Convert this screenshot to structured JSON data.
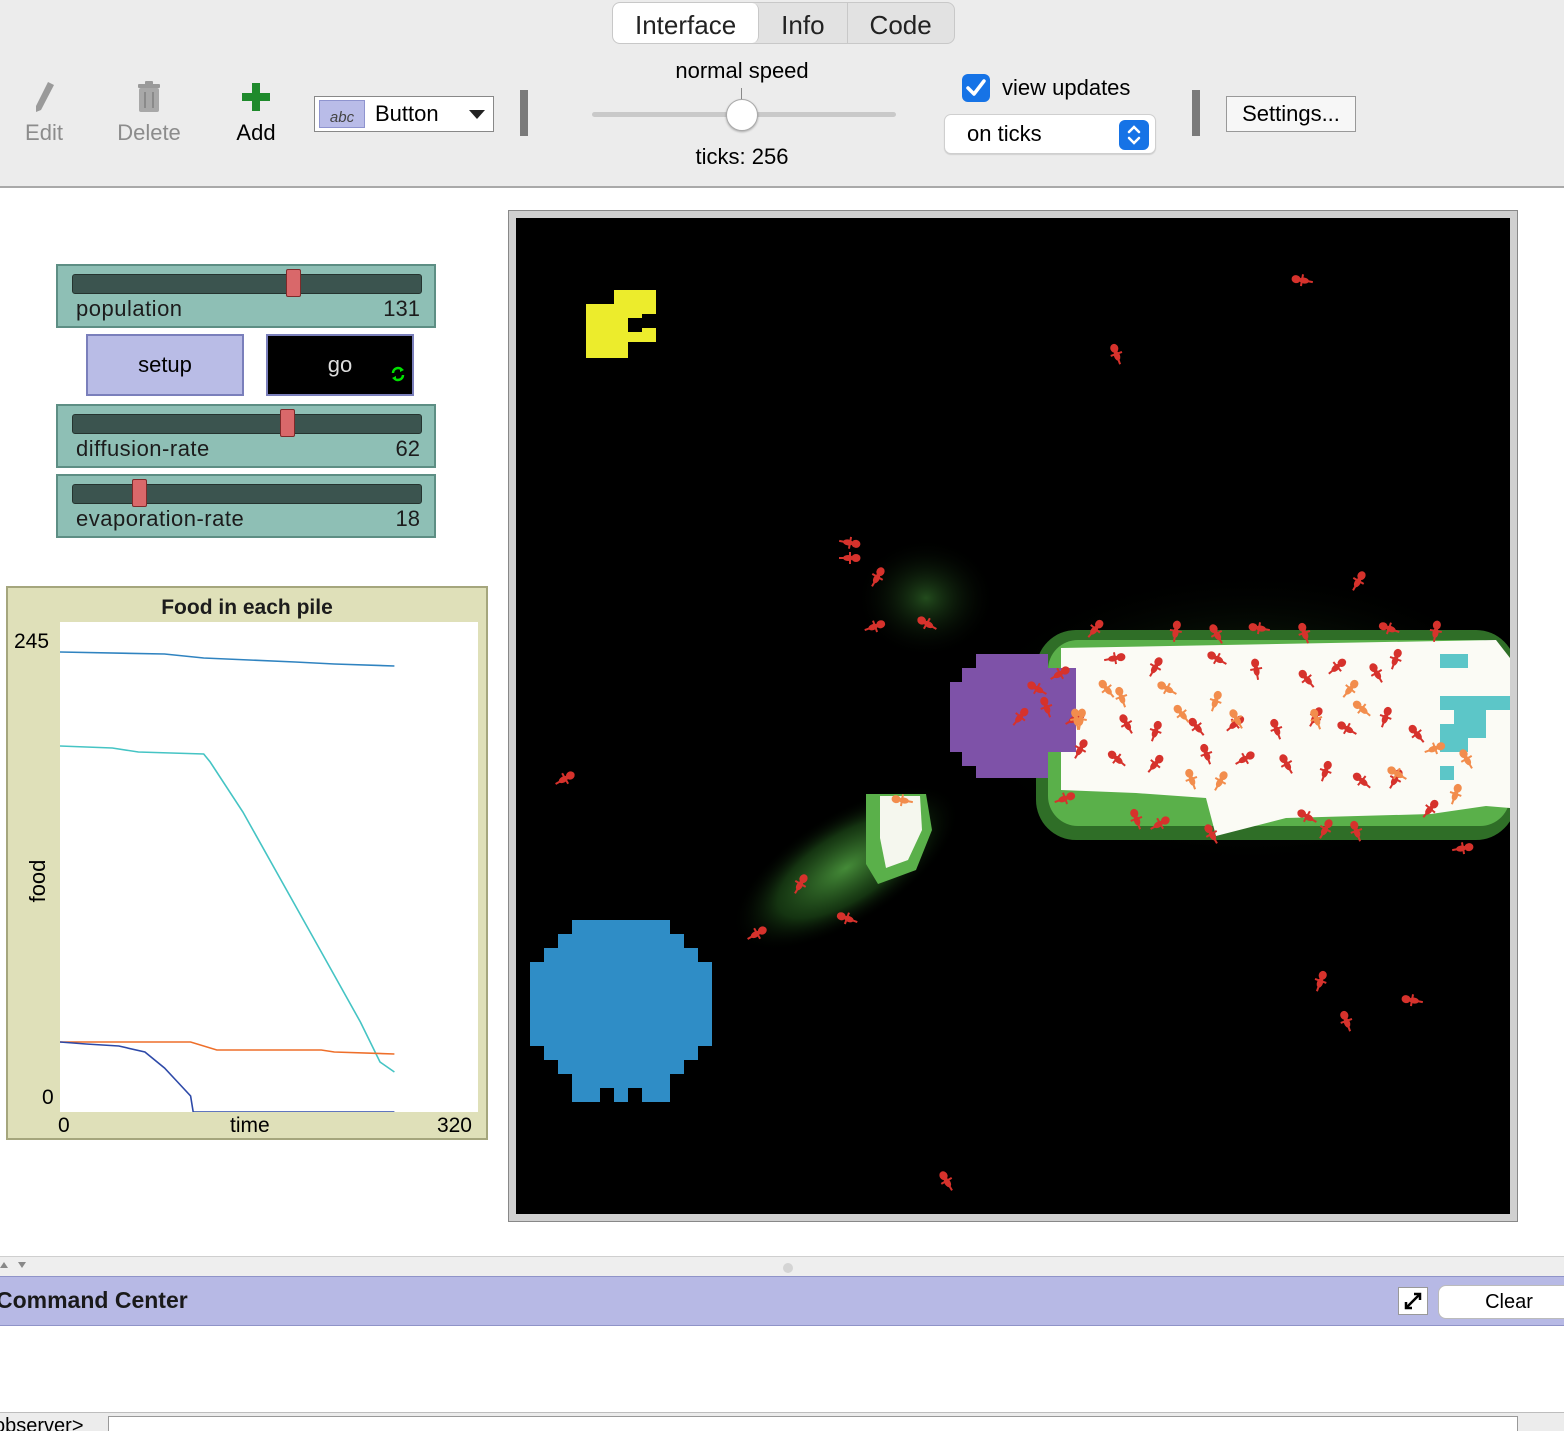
{
  "tabs": [
    "Interface",
    "Info",
    "Code"
  ],
  "toolbar": {
    "edit_label": "Edit",
    "delete_label": "Delete",
    "add_label": "Add",
    "widget_type": "Button",
    "widget_icon_text": "abc",
    "speed_label": "normal speed",
    "ticks_label": "ticks: 256",
    "view_updates_label": "view updates",
    "view_updates_checked": true,
    "update_mode": "on ticks",
    "settings_label": "Settings..."
  },
  "sliders": [
    {
      "name": "population",
      "value": "131",
      "fraction": 0.64
    },
    {
      "name": "diffusion-rate",
      "value": "62",
      "fraction": 0.62
    },
    {
      "name": "evaporation-rate",
      "value": "18",
      "fraction": 0.18
    }
  ],
  "buttons": {
    "setup": "setup",
    "go": "go"
  },
  "plot": {
    "title": "Food in each pile",
    "xlabel": "time",
    "ylabel": "food",
    "xmin": "0",
    "xmax": "320",
    "ymin": "0",
    "ymax": "245"
  },
  "chart_data": {
    "type": "line",
    "title": "Food in each pile",
    "xlabel": "time",
    "ylabel": "food",
    "xlim": [
      0,
      320
    ],
    "ylim": [
      0,
      245
    ],
    "series": [
      {
        "color": "#2f83c0",
        "points": [
          [
            0,
            230
          ],
          [
            80,
            229
          ],
          [
            110,
            227
          ],
          [
            180,
            225
          ],
          [
            210,
            224
          ],
          [
            256,
            223
          ]
        ]
      },
      {
        "color": "#45c4c4",
        "points": [
          [
            0,
            183
          ],
          [
            40,
            182
          ],
          [
            60,
            180
          ],
          [
            110,
            179
          ],
          [
            115,
            175
          ],
          [
            140,
            150
          ],
          [
            170,
            115
          ],
          [
            200,
            80
          ],
          [
            230,
            45
          ],
          [
            245,
            25
          ],
          [
            256,
            20
          ]
        ]
      },
      {
        "color": "#ee6f2a",
        "points": [
          [
            0,
            35
          ],
          [
            100,
            35
          ],
          [
            120,
            31
          ],
          [
            200,
            31
          ],
          [
            210,
            30
          ],
          [
            256,
            29
          ]
        ]
      },
      {
        "color": "#2d49a8",
        "points": [
          [
            0,
            35
          ],
          [
            20,
            34
          ],
          [
            45,
            33
          ],
          [
            65,
            30
          ],
          [
            80,
            22
          ],
          [
            90,
            15
          ],
          [
            100,
            8
          ],
          [
            102,
            0
          ],
          [
            256,
            0
          ]
        ]
      }
    ]
  },
  "world": {
    "colors": {
      "yellow": "#ecec2c",
      "blue": "#2f8dc6",
      "purple": "#7e52a8",
      "cyan": "#5cc6c8",
      "ant": "#d6322c",
      "ant_carrying": "#f28d4d",
      "chemical_light": "#ffffff",
      "chemical_mid": "#5ab04a",
      "chemical_dark": "#1b4d17"
    }
  },
  "command_center": {
    "title": "Command Center",
    "clear_label": "Clear",
    "agent_label": "observer>"
  }
}
